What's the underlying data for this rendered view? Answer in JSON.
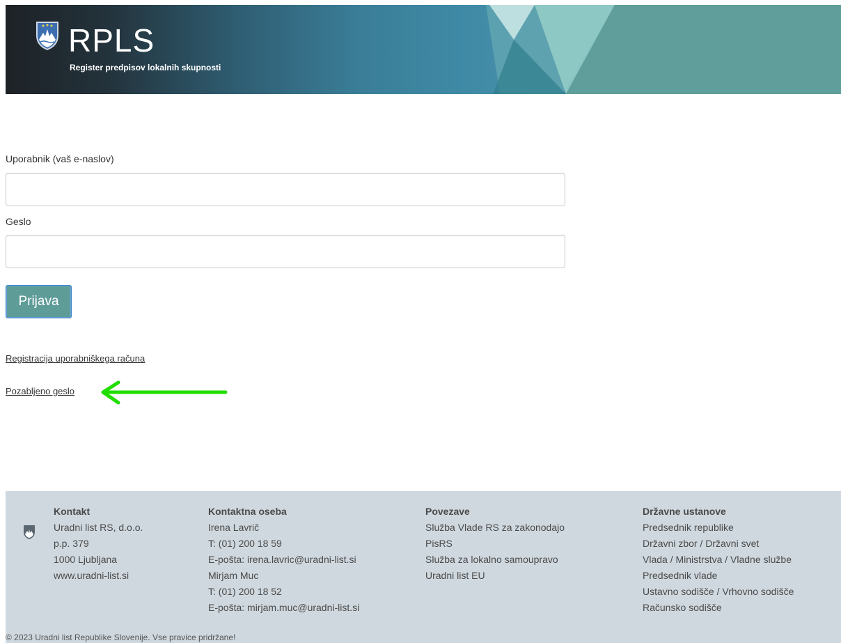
{
  "header": {
    "title": "RPLS",
    "subtitle": "Register predpisov lokalnih skupnosti"
  },
  "login": {
    "username_label": "Uporabnik (vaš e-naslov)",
    "username_value": "",
    "password_label": "Geslo",
    "password_value": "",
    "submit_label": "Prijava",
    "register_link": "Registracija uporabniškega računa",
    "forgot_link": "Pozabljeno geslo"
  },
  "annotation": {
    "color": "#22dd00"
  },
  "footer": {
    "kontakt": {
      "heading": "Kontakt",
      "lines": [
        "Uradni list RS, d.o.o.",
        "p.p. 379",
        "1000 Ljubljana",
        "www.uradni-list.si"
      ]
    },
    "kontaktna_oseba": {
      "heading": "Kontaktna oseba",
      "lines": [
        "Irena Lavrič",
        "T: (01) 200 18 59",
        "E-pošta: irena.lavric@uradni-list.si",
        "Mirjam Muc",
        "T: (01) 200 18 52",
        "E-pošta: mirjam.muc@uradni-list.si"
      ]
    },
    "povezave": {
      "heading": "Povezave",
      "lines": [
        "Služba Vlade RS za zakonodajo",
        "PisRS",
        "Služba za lokalno samoupravo",
        "Uradni list EU"
      ]
    },
    "drzavne_ustanove": {
      "heading": "Državne ustanove",
      "lines": [
        "Predsednik republike",
        "Državni zbor / Državni svet",
        "Vlada / Ministrstva / Vladne službe",
        "Predsednik vlade",
        "Ustavno sodišče / Vrhovno sodišče",
        "Računsko sodišče"
      ]
    },
    "copyright": "© 2023 Uradni list Republike Slovenije. Vse pravice pridržane!"
  },
  "colors": {
    "button_bg": "#5e9c98",
    "footer_bg": "#cfd8df",
    "banner_teal": "#5f9e9a"
  }
}
